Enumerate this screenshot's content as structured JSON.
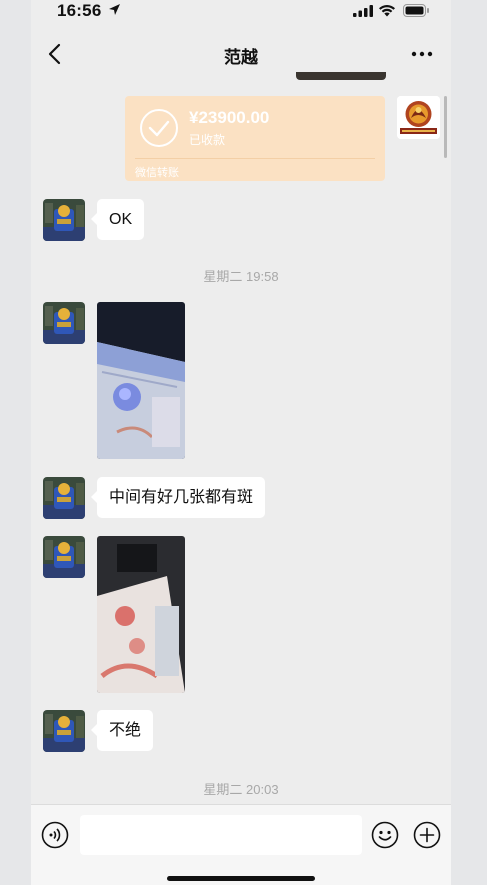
{
  "status_bar": {
    "time": "16:56"
  },
  "nav": {
    "title": "范越"
  },
  "messages": {
    "transfer": {
      "amount": "¥23900.00",
      "status": "已收款",
      "label": "微信转账"
    },
    "ok_text": "OK",
    "timestamp_1": "星期二 19:58",
    "text_spots": "中间有好几张都有斑",
    "text_buju": "不绝",
    "timestamp_2": "星期二 20:03"
  },
  "input": {
    "placeholder": ""
  },
  "colors": {
    "transfer_bg": "#fbe1c3",
    "chat_bg": "#ededed",
    "bubble_bg": "#ffffff",
    "timestamp": "#a8a8a8"
  },
  "icons": [
    "location-arrow-icon",
    "signal-icon",
    "wifi-icon",
    "battery-icon",
    "back-arrow-icon",
    "more-icon",
    "check-circle-icon",
    "voice-icon",
    "emoji-icon",
    "plus-icon"
  ]
}
